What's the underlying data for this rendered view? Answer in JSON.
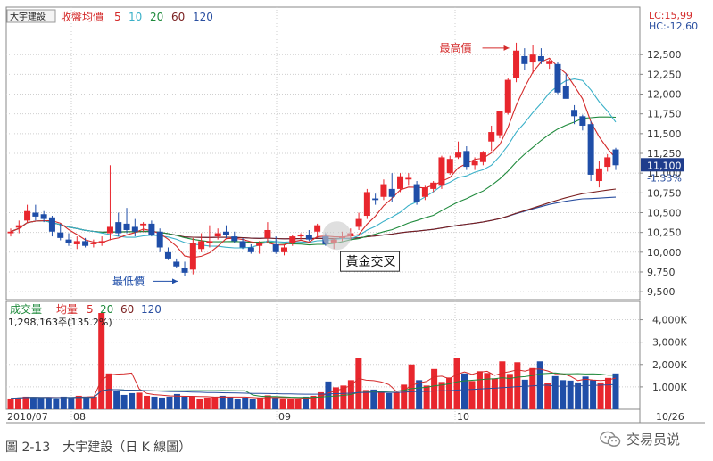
{
  "chart_data": [
    {
      "type": "candlestick",
      "title": "大宇建設",
      "ma_label": "收盤均價",
      "ma_periods": [
        "5",
        "10",
        "20",
        "60",
        "120"
      ],
      "ylim": [
        9400,
        13100
      ],
      "y_ticks": [
        "12,500",
        "12,250",
        "12,000",
        "11,750",
        "11,500",
        "11,250",
        "11,000",
        "10,750",
        "10,500",
        "10,250",
        "10,000",
        "9,750",
        "9,500"
      ],
      "lc_label": "LC:15,99",
      "hc_label": "HC:-12,60",
      "last_price": "11,100",
      "last_change": "-1.33%",
      "candles": [
        [
          10240,
          10300,
          10200,
          10260
        ],
        [
          10310,
          10400,
          10240,
          10340
        ],
        [
          10400,
          10600,
          10380,
          10520
        ],
        [
          10500,
          10600,
          10400,
          10450
        ],
        [
          10480,
          10520,
          10380,
          10420
        ],
        [
          10440,
          10460,
          10200,
          10260
        ],
        [
          10250,
          10360,
          10150,
          10180
        ],
        [
          10160,
          10240,
          10080,
          10120
        ],
        [
          10100,
          10200,
          10040,
          10140
        ],
        [
          10140,
          10180,
          10060,
          10080
        ],
        [
          10100,
          10160,
          10060,
          10120
        ],
        [
          10120,
          10200,
          10080,
          10140
        ],
        [
          10240,
          11100,
          10150,
          10320
        ],
        [
          10380,
          10500,
          10200,
          10240
        ],
        [
          10360,
          10560,
          10240,
          10280
        ],
        [
          10320,
          10420,
          10200,
          10260
        ],
        [
          10340,
          10380,
          10260,
          10360
        ],
        [
          10360,
          10400,
          10200,
          10220
        ],
        [
          10260,
          10300,
          10000,
          10060
        ],
        [
          10000,
          10060,
          9900,
          9920
        ],
        [
          9880,
          9920,
          9800,
          9820
        ],
        [
          9800,
          9880,
          9700,
          9740
        ],
        [
          9780,
          10180,
          9720,
          10120
        ],
        [
          10040,
          10240,
          10000,
          10140
        ],
        [
          10120,
          10340,
          10060,
          10140
        ],
        [
          10200,
          10300,
          10160,
          10240
        ],
        [
          10260,
          10340,
          10180,
          10220
        ],
        [
          10200,
          10260,
          10120,
          10140
        ],
        [
          10140,
          10180,
          10040,
          10060
        ],
        [
          10060,
          10100,
          9980,
          10000
        ],
        [
          10080,
          10140,
          9980,
          10120
        ],
        [
          10180,
          10380,
          10120,
          10280
        ],
        [
          10100,
          10200,
          9980,
          10000
        ],
        [
          10000,
          10100,
          9960,
          10060
        ],
        [
          10120,
          10220,
          10080,
          10200
        ],
        [
          10200,
          10240,
          10160,
          10220
        ],
        [
          10220,
          10280,
          10140,
          10160
        ],
        [
          10260,
          10360,
          10180,
          10340
        ],
        [
          10200,
          10240,
          10080,
          10100
        ],
        [
          10120,
          10180,
          10040,
          10160
        ],
        [
          10180,
          10260,
          10140,
          10200
        ],
        [
          10200,
          10300,
          10160,
          10240
        ],
        [
          10320,
          10500,
          10280,
          10420
        ],
        [
          10460,
          10800,
          10420,
          10760
        ],
        [
          10680,
          10740,
          10600,
          10660
        ],
        [
          10700,
          10920,
          10660,
          10860
        ],
        [
          10800,
          11000,
          10640,
          10700
        ],
        [
          10800,
          11000,
          10760,
          10960
        ],
        [
          10920,
          11000,
          10840,
          10940
        ],
        [
          10860,
          10900,
          10600,
          10640
        ],
        [
          10700,
          10840,
          10660,
          10820
        ],
        [
          10800,
          10900,
          10760,
          10880
        ],
        [
          10840,
          11220,
          10800,
          11200
        ],
        [
          11000,
          11220,
          10980,
          11180
        ],
        [
          11200,
          11400,
          11180,
          11260
        ],
        [
          11280,
          11340,
          11040,
          11080
        ],
        [
          11100,
          11200,
          11040,
          11160
        ],
        [
          11140,
          11280,
          11100,
          11260
        ],
        [
          11400,
          11600,
          11280,
          11520
        ],
        [
          11480,
          11760,
          11440,
          11780
        ],
        [
          11760,
          12200,
          11740,
          12180
        ],
        [
          12200,
          12650,
          12150,
          12550
        ],
        [
          12480,
          12580,
          12300,
          12380
        ],
        [
          12400,
          12620,
          12260,
          12500
        ],
        [
          12480,
          12580,
          12380,
          12420
        ],
        [
          12380,
          12440,
          12320,
          12420
        ],
        [
          12380,
          12400,
          12000,
          12020
        ],
        [
          12100,
          12260,
          11960,
          11940
        ],
        [
          11800,
          11860,
          11620,
          11720
        ],
        [
          11720,
          11740,
          11540,
          11600
        ],
        [
          11620,
          11660,
          10900,
          10980
        ],
        [
          10900,
          11150,
          10820,
          11060
        ],
        [
          11080,
          11240,
          11020,
          11200
        ],
        [
          11300,
          11320,
          11040,
          11100
        ]
      ],
      "annotations": {
        "high": "最高價",
        "low": "最低價",
        "golden_cross": "黃金交叉"
      },
      "x_labels": [
        "2010/07",
        "08",
        "09",
        "10",
        "10/26"
      ]
    },
    {
      "type": "bar",
      "title": "成交量",
      "avg_label": "均量",
      "ma_periods": [
        "5",
        "20",
        "60",
        "120"
      ],
      "info": "1,298,163주(135.2%)",
      "y_ticks": [
        "4,000K",
        "3,000K",
        "2,000K",
        "1,000K"
      ],
      "ylim": [
        0,
        4500
      ],
      "values": [
        480,
        520,
        560,
        540,
        500,
        520,
        480,
        560,
        520,
        600,
        560,
        560,
        4300,
        1600,
        820,
        640,
        720,
        740,
        600,
        560,
        520,
        560,
        680,
        560,
        560,
        480,
        520,
        560,
        600,
        540,
        480,
        520,
        460,
        500,
        620,
        520,
        480,
        460,
        440,
        560,
        600,
        760,
        1240,
        980,
        1060,
        1300,
        2300,
        860,
        880,
        760,
        720,
        760,
        1100,
        2000,
        1300,
        1060,
        1800,
        1220,
        1420,
        2300,
        1600,
        1260,
        1700,
        1620,
        1380,
        2140,
        1580,
        2100,
        1320,
        1840,
        2140,
        1160,
        1480,
        1300,
        1280,
        1200,
        1460,
        1300,
        1200,
        1400,
        1600
      ]
    }
  ],
  "caption": "圖 2-13　大宇建設（日 K 線圖）",
  "brand": "交易员说",
  "colors": {
    "up": "#e8262d",
    "down": "#1f4ea8",
    "ma5": "#d42a2a",
    "ma10": "#3ab0c8",
    "ma20": "#1f8a3c",
    "ma60": "#7a1f1f",
    "ma120": "#2a4fa0"
  }
}
